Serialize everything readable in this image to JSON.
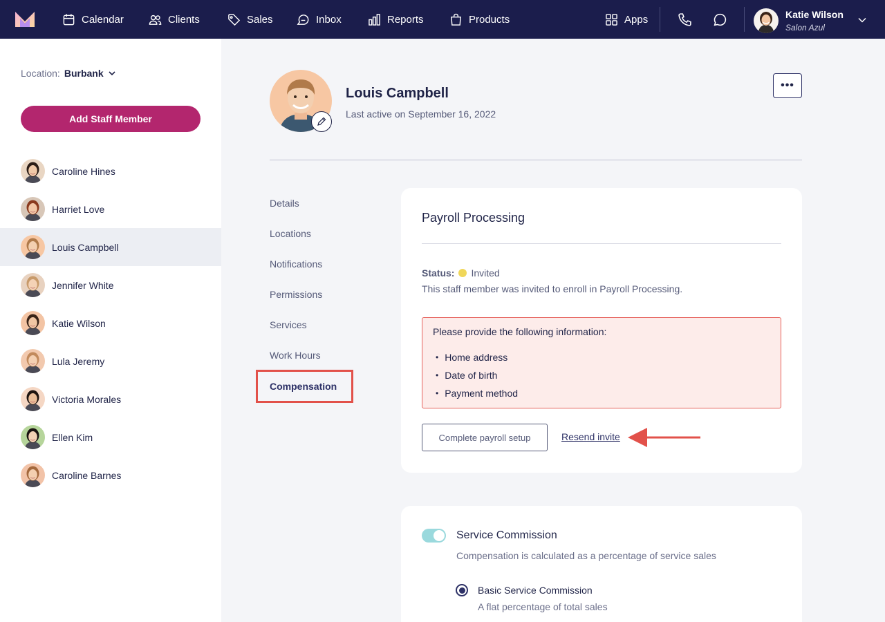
{
  "nav": {
    "items": [
      {
        "label": "Calendar",
        "icon": "calendar-icon"
      },
      {
        "label": "Clients",
        "icon": "clients-icon"
      },
      {
        "label": "Sales",
        "icon": "tag-icon"
      },
      {
        "label": "Inbox",
        "icon": "inbox-icon"
      },
      {
        "label": "Reports",
        "icon": "bar-chart-icon"
      },
      {
        "label": "Products",
        "icon": "shopping-bag-icon"
      }
    ],
    "apps_label": "Apps",
    "user": {
      "name": "Katie Wilson",
      "salon": "Salon Azul"
    }
  },
  "sidebar": {
    "location_label": "Location:",
    "location_value": "Burbank",
    "add_staff_label": "Add Staff Member",
    "staff": [
      {
        "name": "Caroline Hines",
        "hair": "#2b1d16",
        "skin": "#f0c9a8",
        "bg": "#e9d6c3"
      },
      {
        "name": "Harriet Love",
        "hair": "#8a3a1e",
        "skin": "#f2c7a6",
        "bg": "#d8c7b8"
      },
      {
        "name": "Louis Campbell",
        "hair": "#b07a4a",
        "skin": "#f3cfb0",
        "bg": "#f7c7a3"
      },
      {
        "name": "Jennifer White",
        "hair": "#c89a6a",
        "skin": "#f4d2b6",
        "bg": "#e8d2c0"
      },
      {
        "name": "Katie Wilson",
        "hair": "#3a2418",
        "skin": "#f1c6a3",
        "bg": "#f3c4a4"
      },
      {
        "name": "Lula Jeremy",
        "hair": "#c28a5c",
        "skin": "#f4d0b2",
        "bg": "#f2c9ae"
      },
      {
        "name": "Victoria Morales",
        "hair": "#1e1410",
        "skin": "#e9bd98",
        "bg": "#f5d7c4"
      },
      {
        "name": "Ellen Kim",
        "hair": "#1a1310",
        "skin": "#f3d1b4",
        "bg": "#b6d59b"
      },
      {
        "name": "Caroline Barnes",
        "hair": "#a4683c",
        "skin": "#f4cfb0",
        "bg": "#f2c3a8"
      }
    ],
    "active_index": 2
  },
  "profile": {
    "name": "Louis Campbell",
    "last_active": "Last active on September 16, 2022",
    "more_label": "•••"
  },
  "subnav": {
    "items": [
      "Details",
      "Locations",
      "Notifications",
      "Permissions",
      "Services",
      "Work Hours"
    ],
    "active": "Compensation"
  },
  "payroll": {
    "title": "Payroll Processing",
    "status_label": "Status:",
    "status_value": "Invited",
    "status_color": "#f0d75a",
    "status_desc": "This staff member was invited to enroll in Payroll Processing.",
    "alert_title": "Please provide the following information:",
    "alert_items": [
      "Home address",
      "Date of birth",
      "Payment method"
    ],
    "complete_label": "Complete payroll setup",
    "resend_label": "Resend invite"
  },
  "commission": {
    "title": "Service Commission",
    "desc": "Compensation is calculated as a percentage of service sales",
    "toggle_on": true,
    "option_label": "Basic Service Commission",
    "option_desc": "A flat percentage of total sales"
  },
  "colors": {
    "nav_bg": "#1b1d4c",
    "accent": "#b3266e",
    "highlight": "#e2514a"
  }
}
